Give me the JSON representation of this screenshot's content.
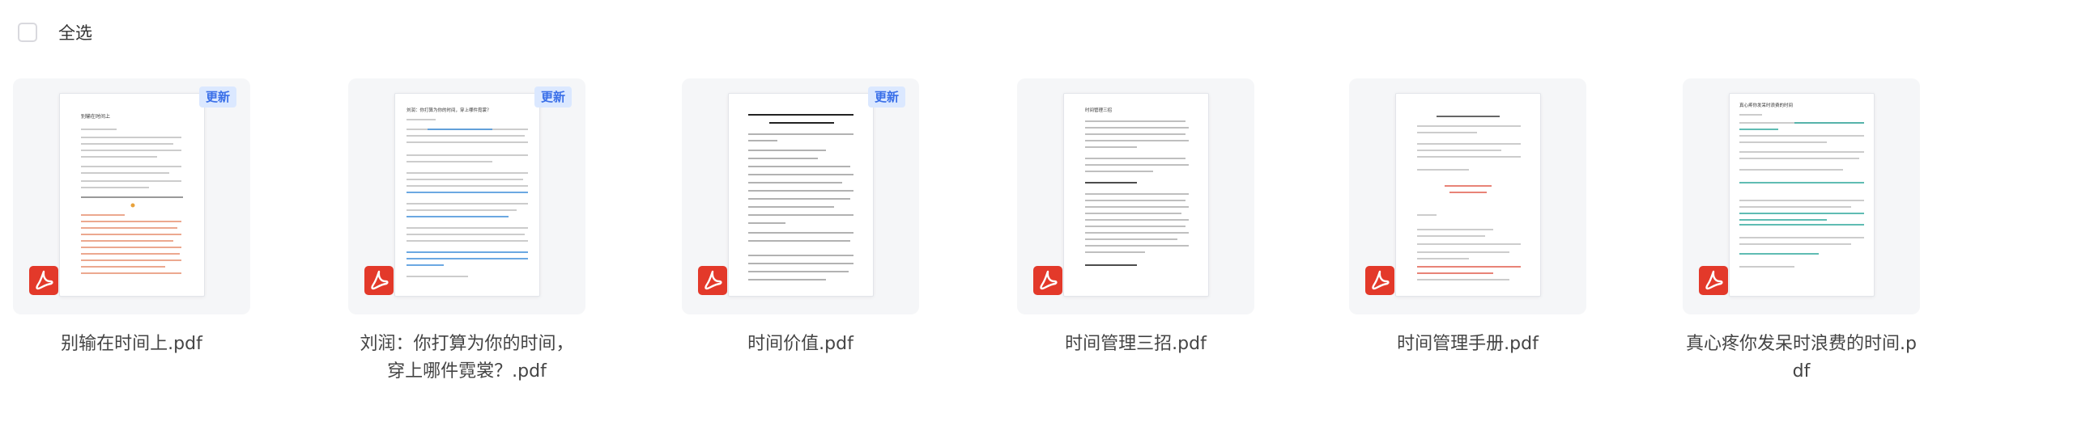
{
  "select_all": {
    "label": "全选"
  },
  "files": [
    {
      "name": "别输在时间上.pdf",
      "badge": "更新",
      "preview_title": "别输在时间上"
    },
    {
      "name": "刘润：你打算为你的时间，穿上哪件霓裳？.pdf",
      "badge": "更新",
      "preview_title": "刘润：你打算为你的时间，穿上哪件霓裳？"
    },
    {
      "name": "时间价值.pdf",
      "badge": "更新",
      "preview_title": ""
    },
    {
      "name": "时间管理三招.pdf",
      "badge": "",
      "preview_title": "时间管理三招"
    },
    {
      "name": "时间管理手册.pdf",
      "badge": "",
      "preview_title": ""
    },
    {
      "name": "真心疼你发呆时浪费的时间.pdf",
      "badge": "",
      "preview_title": "真心疼你发呆时浪费的时间"
    }
  ],
  "icons": {
    "file_type": "pdf-icon",
    "checkbox": "checkbox-icon"
  },
  "colors": {
    "badge_bg": "#dbe8ff",
    "badge_text": "#3a6fe8",
    "pdf_red": "#e3392a",
    "card_bg": "#f5f6f8"
  }
}
